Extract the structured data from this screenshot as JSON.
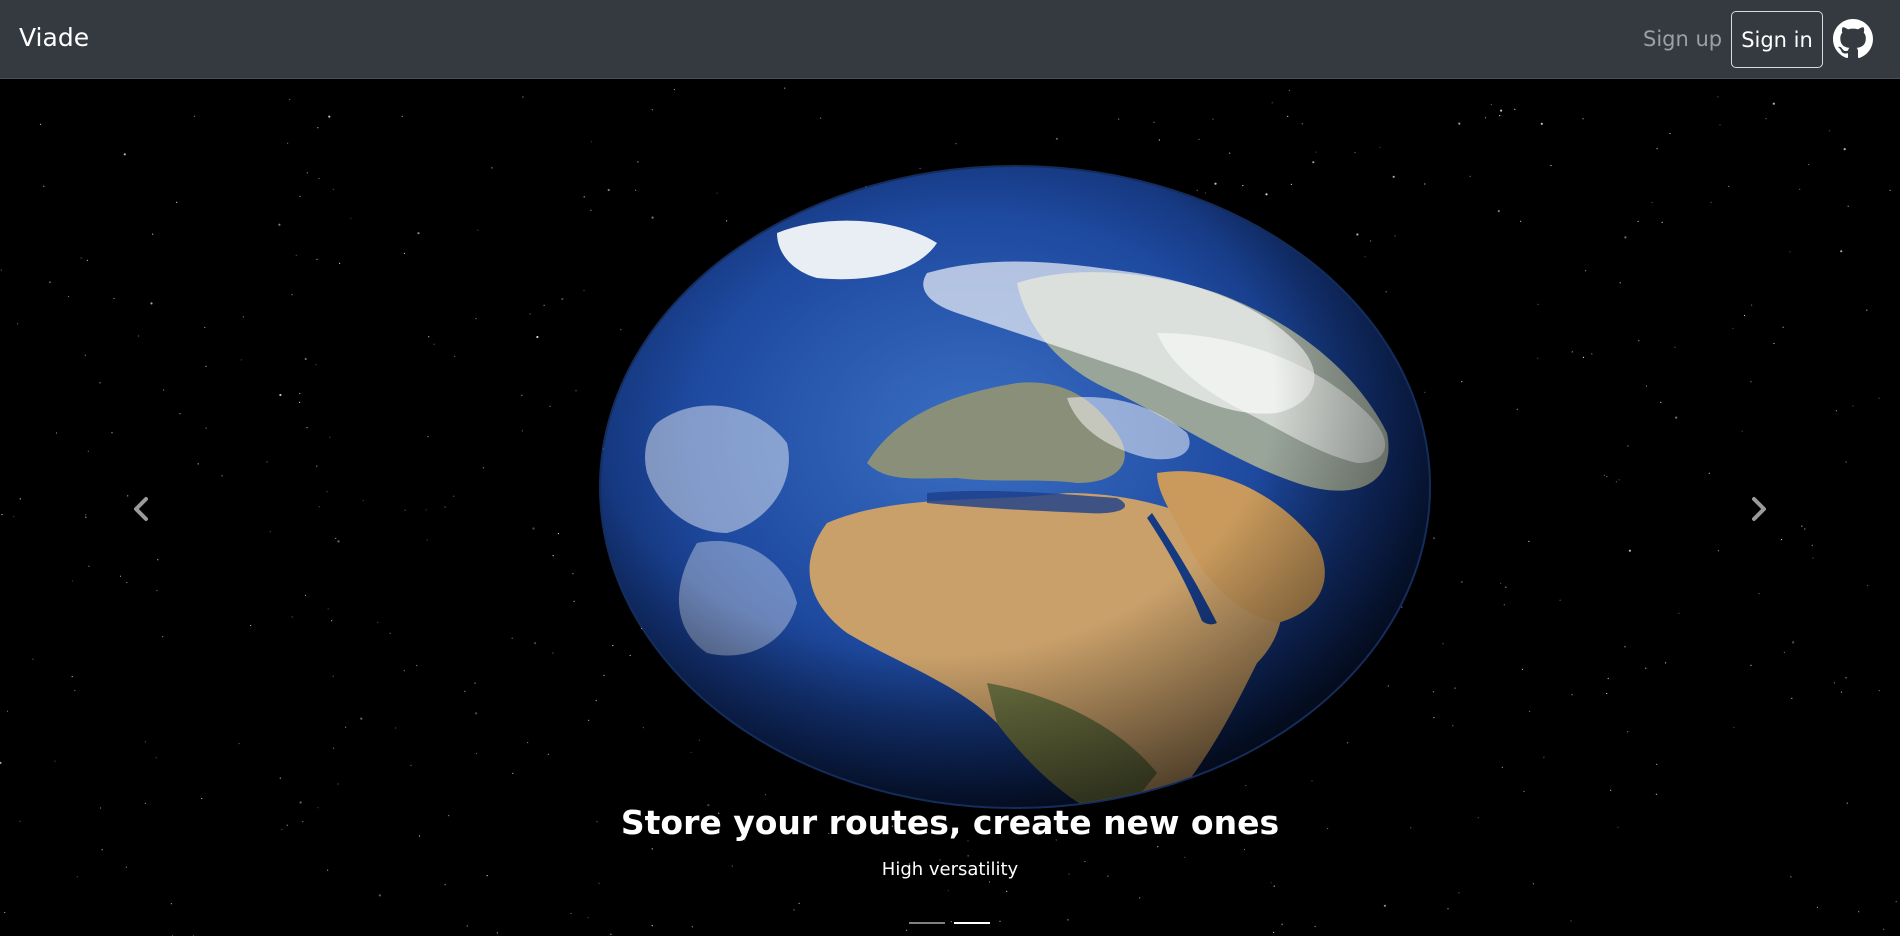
{
  "navbar": {
    "brand": "Viade",
    "signup_label": "Sign up",
    "signin_label": "Sign in",
    "github_icon": "github-icon"
  },
  "carousel": {
    "slide": {
      "title": "Store your routes, create new ones",
      "subtitle": "High versatility",
      "image": "earth-from-space"
    },
    "prev_icon": "chevron-left-icon",
    "next_icon": "chevron-right-icon",
    "indicators": {
      "count": 2,
      "active_index": 1
    }
  },
  "colors": {
    "navbar_bg": "#343a40",
    "text": "#ffffff",
    "muted": "#9aa0a6",
    "ocean": "#1e4aa0",
    "land": "#c9a06a",
    "space": "#000000"
  }
}
